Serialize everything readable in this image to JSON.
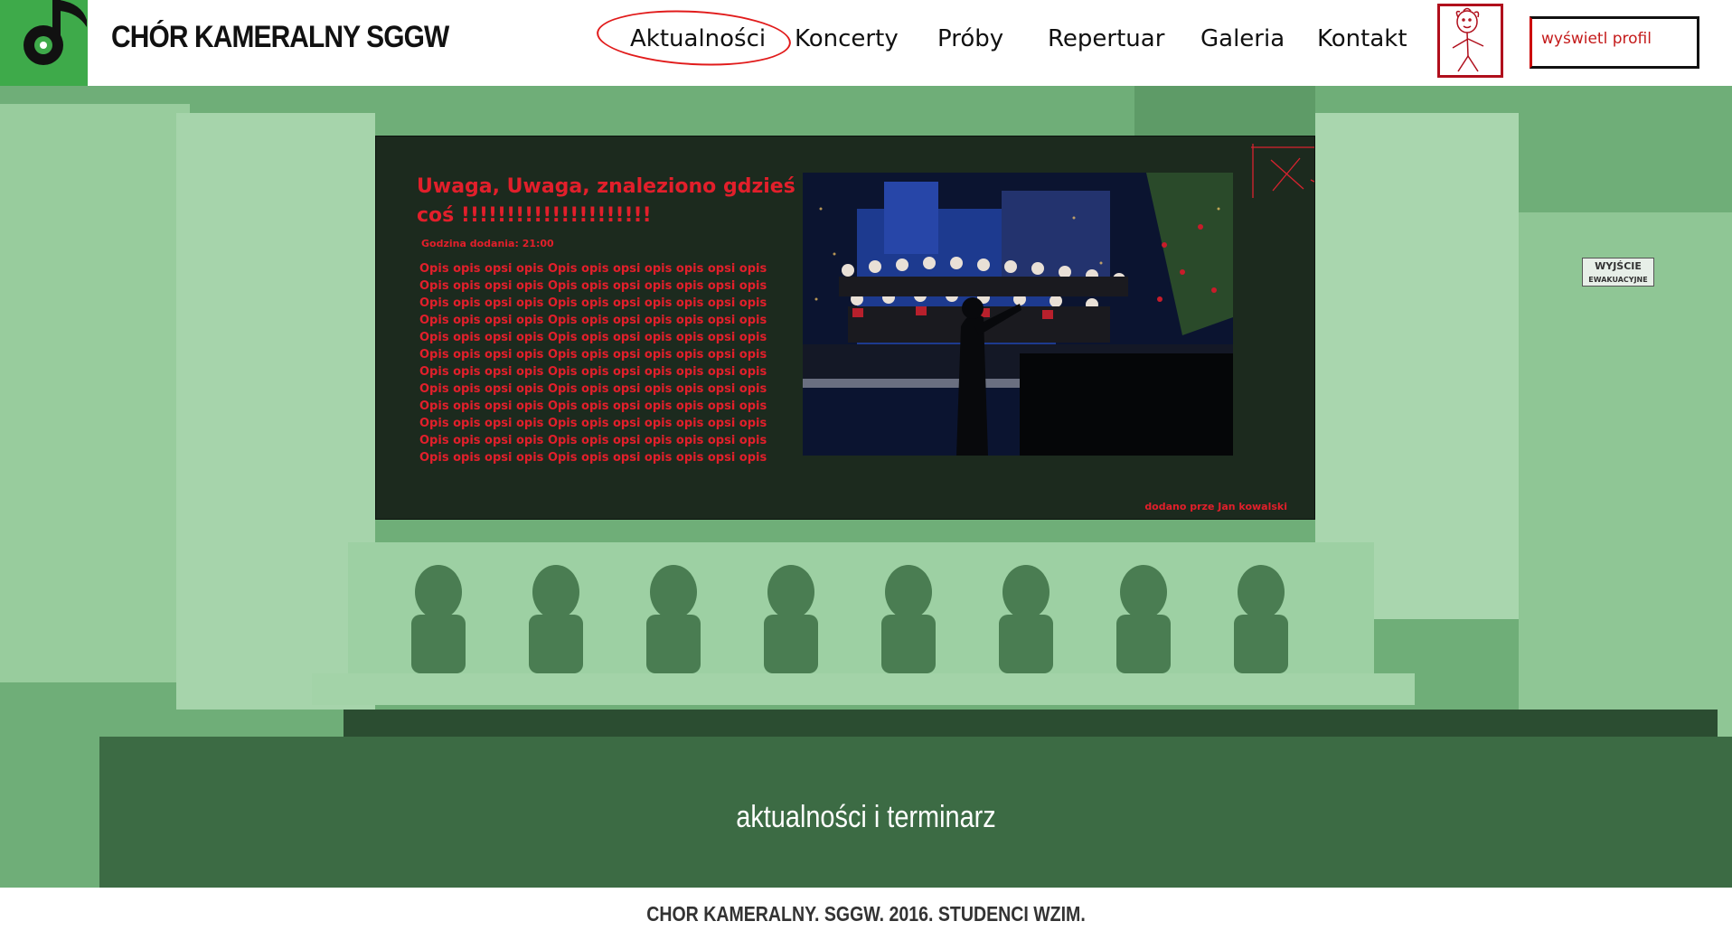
{
  "site": {
    "title": "CHÓR KAMERALNY SGGW"
  },
  "nav": {
    "items": [
      {
        "label": "Aktualności"
      },
      {
        "label": "Koncerty"
      },
      {
        "label": "Próby"
      },
      {
        "label": "Repertuar"
      },
      {
        "label": "Galeria"
      },
      {
        "label": "Kontakt"
      }
    ],
    "active": "Aktualności"
  },
  "profile": {
    "button_label": "wyświetl profil",
    "avatar_icon": "stick-figure-avatar-icon"
  },
  "news": {
    "title": "Uwaga, Uwaga, znaleziono gdzieś coś !!!!!!!!!!!!!!!!!!!!!",
    "time": "Godzina dodania: 21:00",
    "body": "Opis opis opsi opis Opis opis opsi opis opis opsi opis Opis opis opsi opis Opis opis opsi opis opis opsi opis Opis opis opsi opis Opis opis opsi opis opis opsi opis Opis opis opsi opis Opis opis opsi opis opis opsi opis Opis opis opsi opis Opis opis opsi opis opis opsi opis Opis opis opsi opis Opis opis opsi opis opis opsi opis Opis opis opsi opis Opis opis opsi opis opis opsi opis Opis opis opsi opis Opis opis opsi opis opis opsi opis Opis opis opsi opis Opis opis opsi opis opis opsi opis Opis opis opsi opis Opis opis opsi opis opis opsi opis Opis opis opsi opis Opis opis opsi opis opis opsi opis Opis opis opsi opis Opis opis opsi opis opis opsi opis",
    "author": "dodano prze Jan kowalski",
    "close_icon": "close-x-icon",
    "photo": "choir-concert-photo"
  },
  "hero": {
    "caption": "aktualności i terminarz"
  },
  "footer": {
    "text": "CHOR KAMERALNY. SGGW. 2016. STUDENCI WZIM."
  },
  "colors": {
    "brand_green": "#3eaa4a",
    "hero_tint": "#7fbf87",
    "news_bg": "#1c2a1e",
    "news_text": "#e21f2b"
  }
}
